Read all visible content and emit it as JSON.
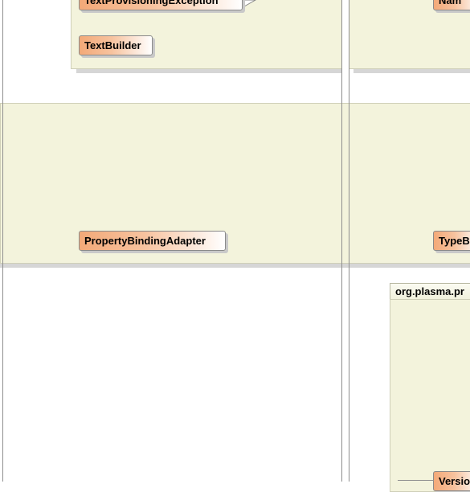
{
  "classes": {
    "text_provisioning_exception": "TextProvisioningException",
    "text_builder": "TextBuilder",
    "property_binding_adapter": "PropertyBindingAdapter",
    "name_partial": "Nam",
    "type_partial": "TypeB",
    "version_partial": "Versio"
  },
  "packages": {
    "org_plasma_partial": "org.plasma.pr"
  },
  "colors": {
    "package_fill": "#f3f3dc",
    "class_gradient_start": "#f3a978",
    "class_gradient_end": "#ffffff",
    "border_line": "#8e8e8e"
  }
}
